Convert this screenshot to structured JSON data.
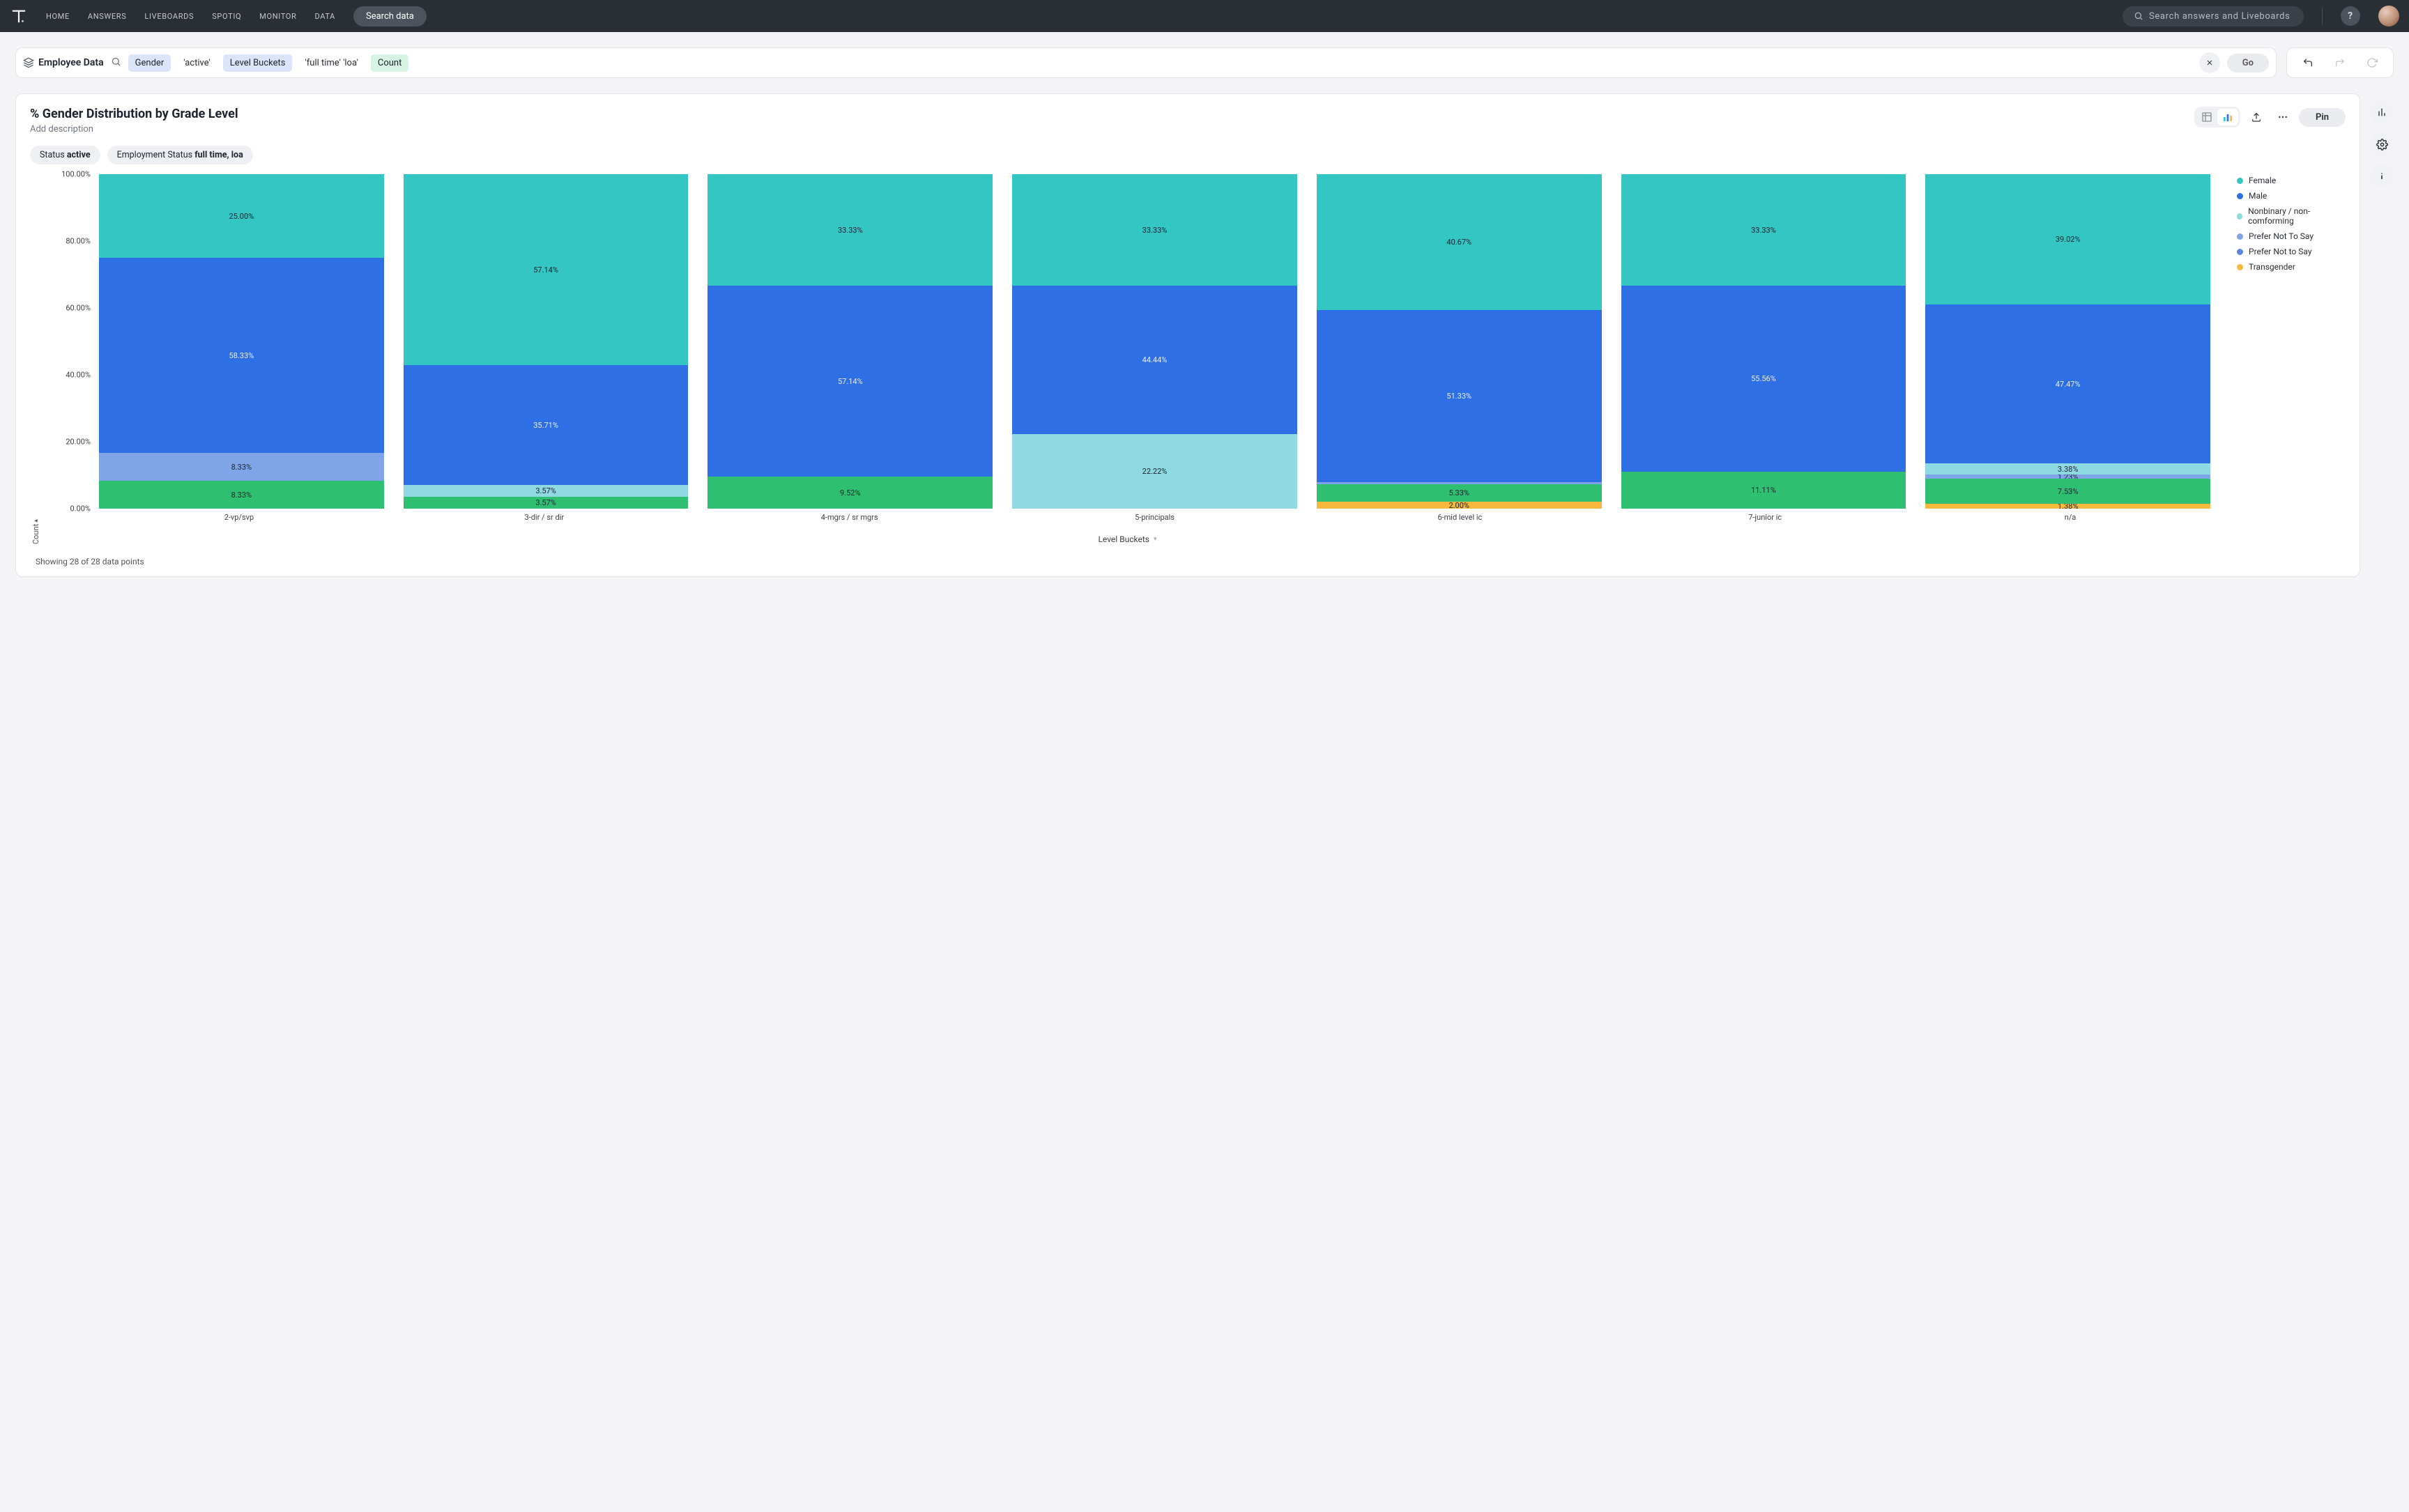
{
  "nav": {
    "items": [
      "HOME",
      "ANSWERS",
      "LIVEBOARDS",
      "SPOTIQ",
      "MONITOR",
      "DATA"
    ],
    "search_data_label": "Search data",
    "global_search_placeholder": "Search answers and Liveboards"
  },
  "source": {
    "label": "Employee Data"
  },
  "query_tokens": [
    {
      "text": "Gender",
      "kind": "attr"
    },
    {
      "text": "'active'",
      "kind": "lit"
    },
    {
      "text": "Level Buckets",
      "kind": "attr"
    },
    {
      "text": "'full time' 'loa'",
      "kind": "lit"
    },
    {
      "text": "Count",
      "kind": "measure"
    }
  ],
  "go_label": "Go",
  "card": {
    "title": "% Gender Distribution by Grade Level",
    "description_placeholder": "Add description",
    "filters": [
      {
        "label": "Status",
        "value": "active"
      },
      {
        "label": "Employment Status",
        "value": "full time, loa"
      }
    ],
    "pin_label": "Pin",
    "footer": "Showing 28 of 28 data points"
  },
  "legend": [
    "Female",
    "Male",
    "Nonbinary / non-comforming",
    "Prefer Not To Say",
    "Prefer Not to Say",
    "Transgender"
  ],
  "legend_colors": {
    "Female": "#34c6c3",
    "Male": "#2f6fe5",
    "Nonbinary / non-comforming": "#8fd9e3",
    "Prefer Not To Say": "#7fa5e8",
    "Prefer Not to Say": "#5a88e0",
    "Transgender": "#f6b83d",
    "_green": "#2fbf71"
  },
  "chart_data": {
    "type": "bar",
    "stacked": true,
    "ylabel": "Count",
    "xlabel": "Level Buckets",
    "ylim": [
      0,
      100
    ],
    "y_ticks": [
      "0.00%",
      "20.00%",
      "40.00%",
      "60.00%",
      "80.00%",
      "100.00%"
    ],
    "categories": [
      "2-vp/svp",
      "3-dir / sr dir",
      "4-mgrs / sr mgrs",
      "5-principals",
      "6-mid level ic",
      "7-junior ic",
      "n/a"
    ],
    "series_order_bottom_to_top": [
      "Transgender",
      "_green",
      "Prefer Not To Say",
      "Nonbinary / non-comforming",
      "Male",
      "Female"
    ],
    "data": {
      "2-vp/svp": {
        "Female": 25.0,
        "Male": 58.33,
        "Prefer Not To Say": 8.33,
        "_green": 8.33
      },
      "3-dir / sr dir": {
        "Female": 57.14,
        "Male": 35.71,
        "Nonbinary / non-comforming": 3.57,
        "_green": 3.57
      },
      "4-mgrs / sr mgrs": {
        "Female": 33.33,
        "Male": 57.14,
        "_green": 9.52
      },
      "5-principals": {
        "Female": 33.33,
        "Male": 44.44,
        "Nonbinary / non-comforming": 22.22
      },
      "6-mid level ic": {
        "Female": 40.67,
        "Male": 51.33,
        "Prefer Not To Say": 0.67,
        "_green": 5.33,
        "Transgender": 2.0
      },
      "7-junior ic": {
        "Female": 33.33,
        "Male": 55.56,
        "_green": 11.11
      },
      "n/a": {
        "Female": 39.02,
        "Male": 47.47,
        "Nonbinary / non-comforming": 3.38,
        "Prefer Not To Say": 1.23,
        "_green": 7.53,
        "Transgender": 1.38
      }
    }
  }
}
